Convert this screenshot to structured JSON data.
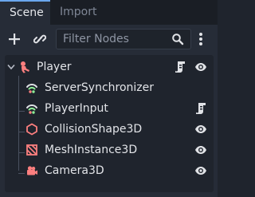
{
  "tabs": [
    {
      "label": "Scene",
      "active": true
    },
    {
      "label": "Import",
      "active": false
    }
  ],
  "toolbar": {
    "filter_placeholder": "Filter Nodes",
    "filter_value": ""
  },
  "tree": {
    "root": {
      "label": "Player",
      "icon": "character-body-icon",
      "expanded": true
    },
    "children": [
      {
        "label": "ServerSynchronizer",
        "icon": "multiplayer-synchronizer-icon"
      },
      {
        "label": "PlayerInput",
        "icon": "multiplayer-synchronizer-icon"
      },
      {
        "label": "CollisionShape3D",
        "icon": "collision-shape-icon"
      },
      {
        "label": "MeshInstance3D",
        "icon": "mesh-instance-icon"
      },
      {
        "label": "Camera3D",
        "icon": "camera-icon"
      }
    ]
  },
  "colors": {
    "background": "#1f242d",
    "panel": "#262c37",
    "accent": "#6aa7ee",
    "node_3d": "#fc7f7f",
    "wifi_green": "#8eef97"
  }
}
